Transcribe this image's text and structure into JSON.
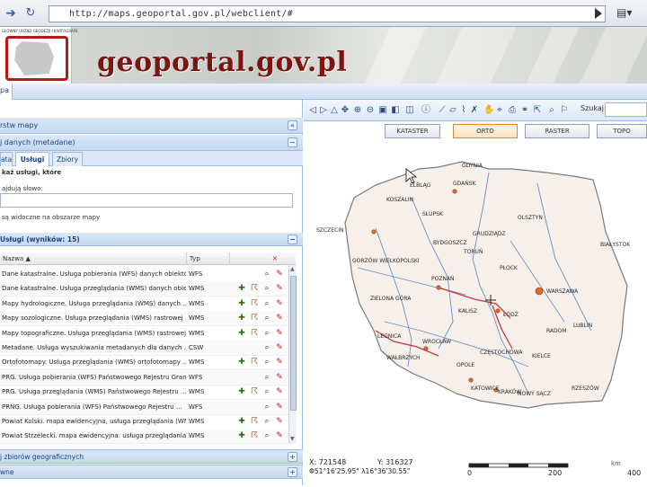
{
  "browser": {
    "url": "http://maps.geoportal.gov.pl/webclient/#"
  },
  "banner": {
    "title": "geoportal.gov.pl",
    "logo_text": "GŁÓWNY URZĄD GEODEZJI I KARTOGRAFII"
  },
  "tabs": {
    "map_tab": "pa"
  },
  "left": {
    "panel1_title": "rstw mapy",
    "panel2_title": "j danych (metadane)",
    "subtabs": [
      "ata",
      "Usługi",
      "Zbiory"
    ],
    "search_label": "każ usługi, które",
    "field1_label": "ajdują słowo:",
    "field2_label": "są widoczne na obszarze mapy",
    "results_header": "Usługi (wyników: 15)",
    "columns": {
      "name": "Nazwa",
      "type": "Typ"
    },
    "rows": [
      {
        "name": "Dane katastralne. Usługa pobierania (WFS) danych obiektów ...",
        "type": "WFS",
        "actions": [
          "zoom",
          "pin"
        ]
      },
      {
        "name": "Dane katastralne. Usługa przeglądania (WMS) danych obiektów ...",
        "type": "WMS",
        "actions": [
          "add",
          "info",
          "zoom",
          "pin"
        ]
      },
      {
        "name": "Mapy hydrologiczne. Usługa przeglądania (WMS) danych ...",
        "type": "WMS",
        "actions": [
          "add",
          "info",
          "zoom",
          "pin"
        ]
      },
      {
        "name": "Mapy sozologiczne. Usługa przeglądania (WMS) rastrowej ...",
        "type": "WMS",
        "actions": [
          "add",
          "info",
          "zoom",
          "pin"
        ]
      },
      {
        "name": "Mapy topograficzne. Usługa przeglądania (WMS) rastrowej ...",
        "type": "WMS",
        "actions": [
          "add",
          "info",
          "zoom",
          "pin"
        ]
      },
      {
        "name": "Metadane. Usługa wyszukiwania metadanych dla danych ...",
        "type": "CSW",
        "actions": [
          "zoom",
          "pin"
        ]
      },
      {
        "name": "Ortofotomapy. Usługa przeglądania (WMS) ortofotomapy ...",
        "type": "WMS",
        "actions": [
          "add",
          "info",
          "zoom",
          "pin"
        ]
      },
      {
        "name": "PRG. Usługa pobierania (WFS) Państwowego Rejestru Granic ...",
        "type": "WFS",
        "actions": [
          "zoom",
          "pin"
        ]
      },
      {
        "name": "PRG. Usługa przeglądania (WMS) Państwowego Rejestru ...",
        "type": "WMS",
        "actions": [
          "add",
          "info",
          "zoom",
          "pin"
        ]
      },
      {
        "name": "PRNG. Usługa pobierania (WFS) Państwowego Rejestru ...",
        "type": "WFS",
        "actions": [
          "zoom",
          "pin"
        ]
      },
      {
        "name": "Powiat Kolski. mapa ewidencyjna, usługa przeglądania (WMS)",
        "type": "WMS",
        "actions": [
          "add",
          "info",
          "zoom",
          "pin"
        ]
      },
      {
        "name": "Powiat Strzelecki. mapa ewidencyjna: usługa przeglądania ...",
        "type": "WMS",
        "actions": [
          "add",
          "info",
          "zoom",
          "pin"
        ]
      }
    ],
    "bottom1_title": "j zbiorów geograficznych",
    "bottom2_title": "wne"
  },
  "map": {
    "search_label": "Szukaj:",
    "layer_buttons": [
      "KATASTER",
      "ORTO",
      "RASTER",
      "TOPO"
    ],
    "active_layer": "ORTO",
    "coord_x": "X: 721548",
    "coord_y": "Y: 316327",
    "coord_geo": "Φ51°16'25.95\"  λ16°36'30.55\"",
    "scale_labels": [
      "0",
      "200",
      "400"
    ],
    "scale_unit": "km",
    "cities": [
      {
        "name": "ELBLĄG"
      },
      {
        "name": "GDYNIA"
      },
      {
        "name": "GDAŃSK"
      },
      {
        "name": "KOSZALIN"
      },
      {
        "name": "SŁUPSK"
      },
      {
        "name": "OLSZTYN"
      },
      {
        "name": "SZCZECIN"
      },
      {
        "name": "GRUDZIĄDZ"
      },
      {
        "name": "BIAŁYSTOK"
      },
      {
        "name": "BYDGOSZCZ"
      },
      {
        "name": "TORUŃ"
      },
      {
        "name": "GORZÓW WIELKOPOLSKI"
      },
      {
        "name": "PŁOCK"
      },
      {
        "name": "POZNAŃ"
      },
      {
        "name": "WARSZAWA"
      },
      {
        "name": "ZIELONA GÓRA"
      },
      {
        "name": "KALISZ"
      },
      {
        "name": "ŁÓDŹ"
      },
      {
        "name": "LUBLIN"
      },
      {
        "name": "RADOM"
      },
      {
        "name": "LEGNICA"
      },
      {
        "name": "WROCŁAW"
      },
      {
        "name": "WAŁBRZYCH"
      },
      {
        "name": "OPOLE"
      },
      {
        "name": "CZĘSTOCHOWA"
      },
      {
        "name": "KIELCE"
      },
      {
        "name": "KATOWICE"
      },
      {
        "name": "KRAKÓW"
      },
      {
        "name": "RZESZÓW"
      },
      {
        "name": "NOWY SĄCZ"
      }
    ]
  }
}
